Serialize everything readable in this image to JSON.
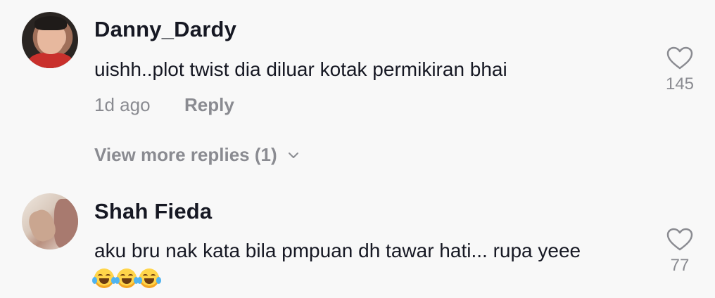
{
  "comments": [
    {
      "username": "Danny_Dardy",
      "text": "uishh..plot twist dia diluar kotak permikiran bhai",
      "time": "1d ago",
      "reply_label": "Reply",
      "likes": "145",
      "view_more": "View more replies (1)"
    },
    {
      "username": "Shah Fieda",
      "text": "aku bru nak kata bila pmpuan dh tawar hati... rupa yeee",
      "emoji": "😂😂😂",
      "likes": "77"
    }
  ],
  "icons": {
    "like": "heart-outline-icon",
    "expand": "chevron-down-icon",
    "emoji": "face-with-tears-of-joy"
  },
  "colors": {
    "background": "#f8f8f8",
    "primary_text": "#161823",
    "secondary_text": "#8a8b91"
  }
}
